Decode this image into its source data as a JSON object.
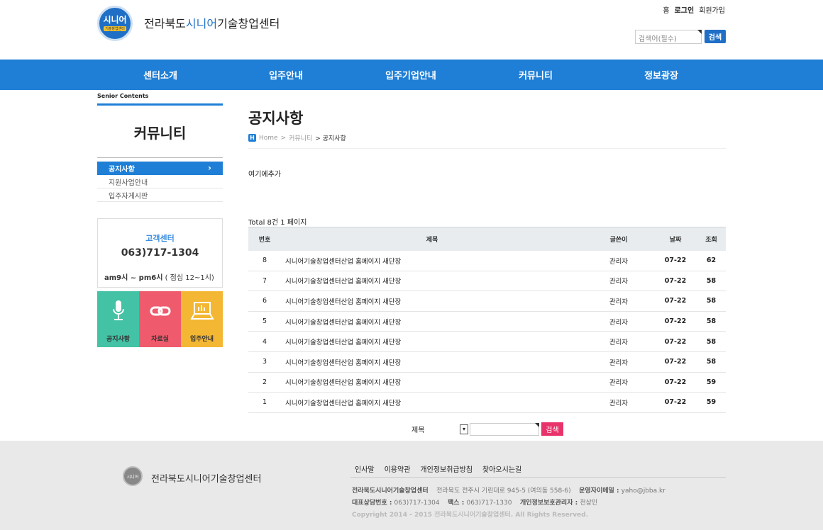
{
  "header": {
    "logo_big": "시니어",
    "logo_small": "기술창업센터",
    "title_prefix": "전라북도",
    "title_accent": "시니어",
    "title_suffix": "기술창업센터",
    "util_links": [
      "홈",
      "로그인",
      "회원가입"
    ],
    "search_placeholder": "검색어(필수)",
    "search_button": "검색"
  },
  "gnb": [
    "센터소개",
    "입주안내",
    "입주기업안내",
    "커뮤니티",
    "정보광장"
  ],
  "sidebar": {
    "label": "Senior Contents",
    "title": "커뮤니티",
    "items": [
      {
        "label": "공지사항",
        "active": true
      },
      {
        "label": "지원사업안내",
        "active": false
      },
      {
        "label": "입주자게시판",
        "active": false
      }
    ],
    "cs": {
      "title": "고객센터",
      "phone": "063)717-1304",
      "hours_start": "am9시",
      "hours_sep": " ~ ",
      "hours_end": "pm6시",
      "hours_note": " ( 점심 12~1시)"
    },
    "quick": [
      {
        "label": "공지사항",
        "color": "#43c2a5",
        "icon": "microphone-icon"
      },
      {
        "label": "자료실",
        "color": "#ef5a6d",
        "icon": "link-icon"
      },
      {
        "label": "입주안내",
        "color": "#f4b733",
        "icon": "laptop-icon"
      }
    ]
  },
  "content": {
    "title": "공지사항",
    "breadcrumb_home": "Home",
    "breadcrumb_sep1": " > ",
    "breadcrumb_mid": "커뮤니티",
    "breadcrumb_current": " > 공지사항",
    "note": "여기에추가",
    "total": "Total 8건 1 페이지",
    "columns": {
      "no": "번호",
      "title": "제목",
      "author": "글쓴이",
      "date": "날짜",
      "views": "조회"
    },
    "rows": [
      {
        "no": "8",
        "title": "시니어기술창업센터산업 홈페이지 새단장",
        "author": "관리자",
        "date": "07-22",
        "views": "62"
      },
      {
        "no": "7",
        "title": "시니어기술창업센터산업 홈페이지 새단장",
        "author": "관리자",
        "date": "07-22",
        "views": "58"
      },
      {
        "no": "6",
        "title": "시니어기술창업센터산업 홈페이지 새단장",
        "author": "관리자",
        "date": "07-22",
        "views": "58"
      },
      {
        "no": "5",
        "title": "시니어기술창업센터산업 홈페이지 새단장",
        "author": "관리자",
        "date": "07-22",
        "views": "58"
      },
      {
        "no": "4",
        "title": "시니어기술창업센터산업 홈페이지 새단장",
        "author": "관리자",
        "date": "07-22",
        "views": "58"
      },
      {
        "no": "3",
        "title": "시니어기술창업센터산업 홈페이지 새단장",
        "author": "관리자",
        "date": "07-22",
        "views": "58"
      },
      {
        "no": "2",
        "title": "시니어기술창업센터산업 홈페이지 새단장",
        "author": "관리자",
        "date": "07-22",
        "views": "59"
      },
      {
        "no": "1",
        "title": "시니어기술창업센터산업 홈페이지 새단장",
        "author": "관리자",
        "date": "07-22",
        "views": "59"
      }
    ],
    "search_label": "제목",
    "search_button": "검색"
  },
  "footer": {
    "logo_text": "시니어",
    "name": "전라북도시니어기술창업센터",
    "links": [
      "인사말",
      "이용약관",
      "개인정보취급방침",
      "찾아오시는길"
    ],
    "info1_name": "전라북도시니어기술창업센터",
    "info1_addr": "전라북도 전주시 기린대로 945-5 (여의동 558-6)",
    "info1_email_label": "운영자이메일 : ",
    "info1_email": "yaho@jbba.kr",
    "info2_tel_label": "대표상담번호 : ",
    "info2_tel": "063)717-1304",
    "info2_fax_label": "팩스 : ",
    "info2_fax": "063)717-1330",
    "info2_mgr_label": "개인정보보호관리자 : ",
    "info2_mgr": "천상민",
    "copyright": "Copyright 2014 - 2015 전라북도시니어기술창업센터. All Rights Reserved."
  }
}
